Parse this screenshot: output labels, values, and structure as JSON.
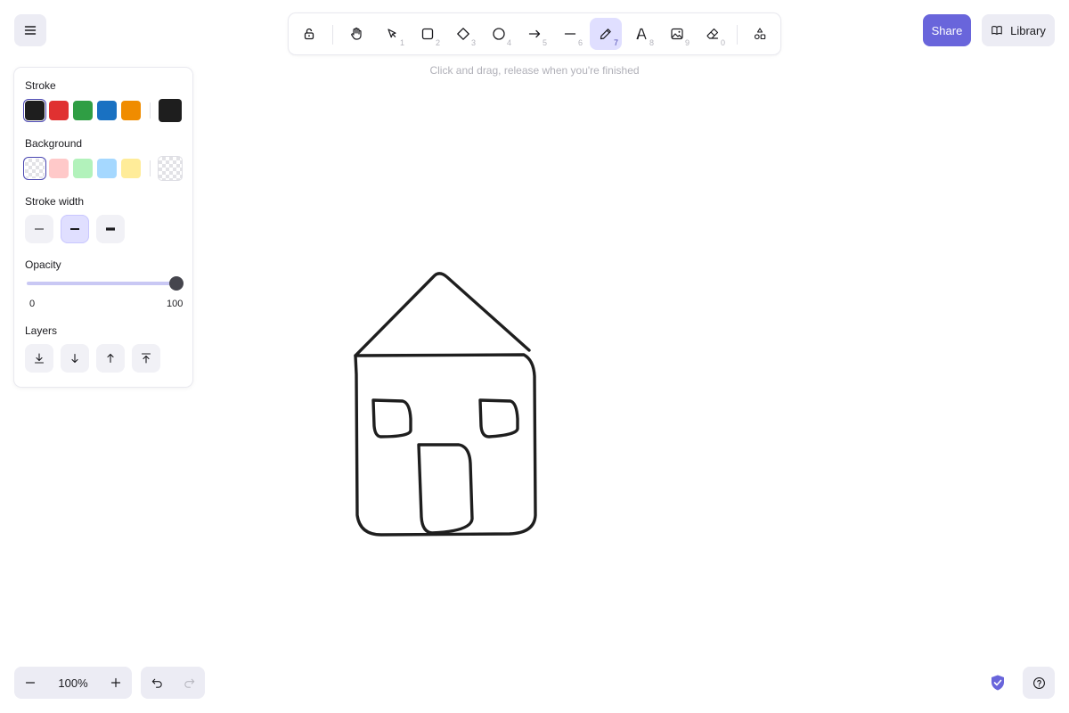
{
  "header": {
    "menu_icon": "hamburger-icon",
    "share_label": "Share",
    "library_label": "Library",
    "accent_color": "#6965db"
  },
  "toolbar": {
    "tools": [
      {
        "name": "lock",
        "icon": "lock-icon",
        "shortcut": ""
      },
      {
        "name": "hand",
        "icon": "hand-icon",
        "shortcut": ""
      },
      {
        "name": "selection",
        "icon": "pointer-icon",
        "shortcut": "1"
      },
      {
        "name": "rectangle",
        "icon": "rectangle-icon",
        "shortcut": "2"
      },
      {
        "name": "diamond",
        "icon": "diamond-icon",
        "shortcut": "3"
      },
      {
        "name": "ellipse",
        "icon": "ellipse-icon",
        "shortcut": "4"
      },
      {
        "name": "arrow",
        "icon": "arrow-icon",
        "shortcut": "5"
      },
      {
        "name": "line",
        "icon": "line-icon",
        "shortcut": "6"
      },
      {
        "name": "draw",
        "icon": "pencil-icon",
        "shortcut": "7",
        "active": true
      },
      {
        "name": "text",
        "icon": "text-icon",
        "shortcut": "8"
      },
      {
        "name": "image",
        "icon": "image-icon",
        "shortcut": "9"
      },
      {
        "name": "eraser",
        "icon": "eraser-icon",
        "shortcut": "0"
      },
      {
        "name": "more-tools",
        "icon": "shapes-icon",
        "shortcut": ""
      }
    ],
    "hint": "Click and drag, release when you're finished"
  },
  "panel": {
    "stroke_label": "Stroke",
    "stroke_colors": [
      "#1e1e1e",
      "#e03131",
      "#2f9e44",
      "#1971c2",
      "#f08c00"
    ],
    "stroke_selected": "#1e1e1e",
    "background_label": "Background",
    "background_colors": [
      "transparent",
      "#ffc9c9",
      "#b2f2bb",
      "#a5d8ff",
      "#ffec99"
    ],
    "background_selected": "transparent",
    "stroke_width_label": "Stroke width",
    "stroke_width_options": [
      "thin",
      "bold",
      "extra-bold"
    ],
    "stroke_width_selected": "bold",
    "opacity_label": "Opacity",
    "opacity_min": "0",
    "opacity_max": "100",
    "opacity_value": 100,
    "layers_label": "Layers",
    "layers_buttons": [
      "send-to-back",
      "send-backward",
      "bring-forward",
      "bring-to-front"
    ]
  },
  "footer": {
    "zoom_value": "100%",
    "zoom_out_icon": "minus-icon",
    "zoom_in_icon": "plus-icon",
    "undo_icon": "undo-icon",
    "redo_icon": "redo-icon",
    "shield_icon": "shield-check-icon",
    "help_icon": "help-icon"
  }
}
